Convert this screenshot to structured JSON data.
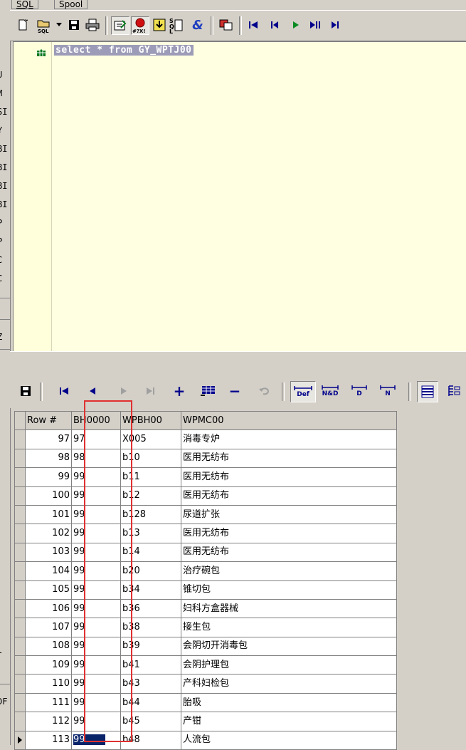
{
  "left_window_fragments": [
    "U",
    "M",
    "SI",
    "Y",
    "BI",
    "BI",
    "BI",
    "BI",
    "P",
    "P",
    "C",
    "C",
    "Z",
    "l",
    "DF"
  ],
  "tabs": [
    {
      "label": "SQL"
    },
    {
      "label": "Spool"
    }
  ],
  "editor": {
    "sql": "select * from GY_WPTJ00"
  },
  "grid": {
    "headers": [
      "Row #",
      "BH0000",
      "WPBH00",
      "WPMC00"
    ],
    "rows": [
      {
        "row": "97",
        "bh": "97",
        "wpbh": "X005",
        "wpmc": "消毒专炉"
      },
      {
        "row": "98",
        "bh": "98",
        "wpbh": "b10",
        "wpmc": "医用无纺布"
      },
      {
        "row": "99",
        "bh": "99",
        "wpbh": "b11",
        "wpmc": "医用无纺布"
      },
      {
        "row": "100",
        "bh": "99",
        "wpbh": "b12",
        "wpmc": "医用无纺布"
      },
      {
        "row": "101",
        "bh": "99",
        "wpbh": "b128",
        "wpmc": "尿道扩张"
      },
      {
        "row": "102",
        "bh": "99",
        "wpbh": "b13",
        "wpmc": "医用无纺布"
      },
      {
        "row": "103",
        "bh": "99",
        "wpbh": "b14",
        "wpmc": "医用无纺布"
      },
      {
        "row": "104",
        "bh": "99",
        "wpbh": "b20",
        "wpmc": "治疗碗包"
      },
      {
        "row": "105",
        "bh": "99",
        "wpbh": "b34",
        "wpmc": "锥切包"
      },
      {
        "row": "106",
        "bh": "99",
        "wpbh": "b36",
        "wpmc": "妇科方盒器械"
      },
      {
        "row": "107",
        "bh": "99",
        "wpbh": "b38",
        "wpmc": "接生包"
      },
      {
        "row": "108",
        "bh": "99",
        "wpbh": "b39",
        "wpmc": "会阴切开消毒包"
      },
      {
        "row": "109",
        "bh": "99",
        "wpbh": "b41",
        "wpmc": "会阴护理包"
      },
      {
        "row": "110",
        "bh": "99",
        "wpbh": "b43",
        "wpmc": "产科妇检包"
      },
      {
        "row": "111",
        "bh": "99",
        "wpbh": "b44",
        "wpmc": "胎吸"
      },
      {
        "row": "112",
        "bh": "99",
        "wpbh": "b45",
        "wpmc": "产钳"
      },
      {
        "row": "113",
        "bh": "99",
        "wpbh": "b48",
        "wpmc": "人流包"
      }
    ]
  },
  "grid_toolbar": {
    "labels": [
      "Def",
      "N&D",
      "D",
      "N"
    ]
  },
  "colors": {
    "highlight": "#e03030",
    "selection": "#0a246a",
    "editor_bg": "#ffffe1"
  },
  "icons": {
    "top": [
      "new-file-icon",
      "open-sql-icon",
      "dropdown-arrow-icon",
      "save-icon",
      "print-icon",
      "execute-query-icon",
      "stop-error-icon",
      "load-results-icon",
      "explain-plan-icon",
      "ampersand-icon",
      "copy-icon",
      "first-record-icon",
      "prior-record-icon",
      "next-record-icon",
      "last-record-icon",
      "more-icon"
    ],
    "grid": [
      "save-icon",
      "first-record-icon",
      "prior-record-icon",
      "next-record-icon",
      "last-record-icon",
      "insert-record-icon",
      "grid-view-icon",
      "delete-record-icon",
      "undo-icon",
      "default-icon",
      "null-default-icon",
      "d-icon",
      "n-icon",
      "grid-mode-icon",
      "form-mode-icon"
    ]
  }
}
